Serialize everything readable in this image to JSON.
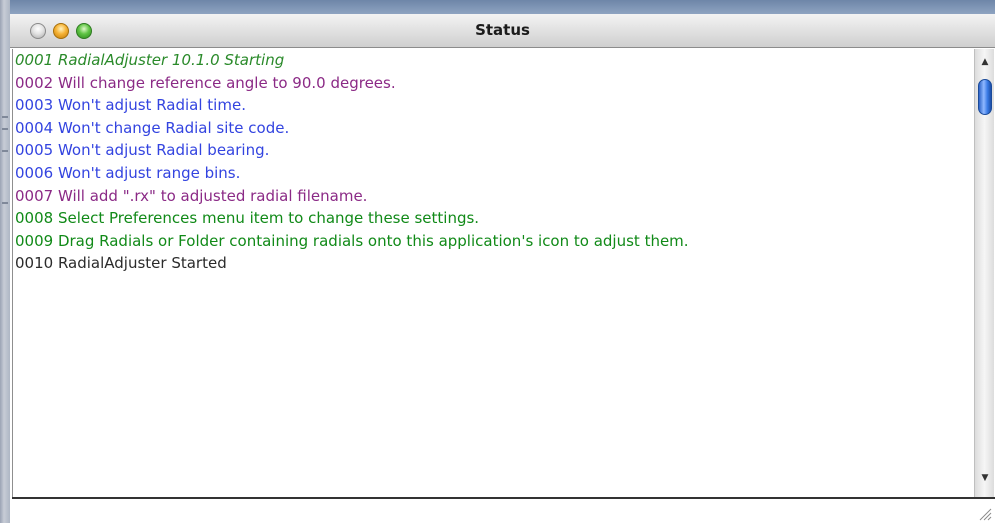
{
  "window": {
    "title": "Status"
  },
  "log": {
    "lines": [
      {
        "text": "0001 RadialAdjuster 10.1.0 Starting",
        "color": "#2a8a2a",
        "italic": true
      },
      {
        "text": "0002 Will change reference angle to 90.0 degrees.",
        "color": "#8b2a86",
        "italic": false
      },
      {
        "text": "0003 Won't adjust Radial time.",
        "color": "#3344e0",
        "italic": false
      },
      {
        "text": "0004 Won't change Radial site code.",
        "color": "#3344e0",
        "italic": false
      },
      {
        "text": "0005 Won't adjust Radial bearing.",
        "color": "#3344e0",
        "italic": false
      },
      {
        "text": "0006 Won't adjust range bins.",
        "color": "#3344e0",
        "italic": false
      },
      {
        "text": "0007 Will add \".rx\" to adjusted radial filename.",
        "color": "#8b2a86",
        "italic": false
      },
      {
        "text": "0008 Select Preferences menu item to change these settings.",
        "color": "#118a18",
        "italic": false
      },
      {
        "text": "0009 Drag Radials or Folder containing radials onto this application's icon to adjust them.",
        "color": "#118a18",
        "italic": false
      },
      {
        "text": "0010 RadialAdjuster Started",
        "color": "#2b2b2b",
        "italic": false
      }
    ]
  },
  "input": {
    "value": ""
  },
  "icons": {
    "close": "close-button-icon",
    "minimize": "minimize-button-icon",
    "zoom": "zoom-button-icon",
    "scroll_up": "arrow-up-icon",
    "scroll_down": "arrow-down-icon",
    "resize": "resize-grip-icon"
  },
  "scroll": {
    "position": 0.0
  }
}
